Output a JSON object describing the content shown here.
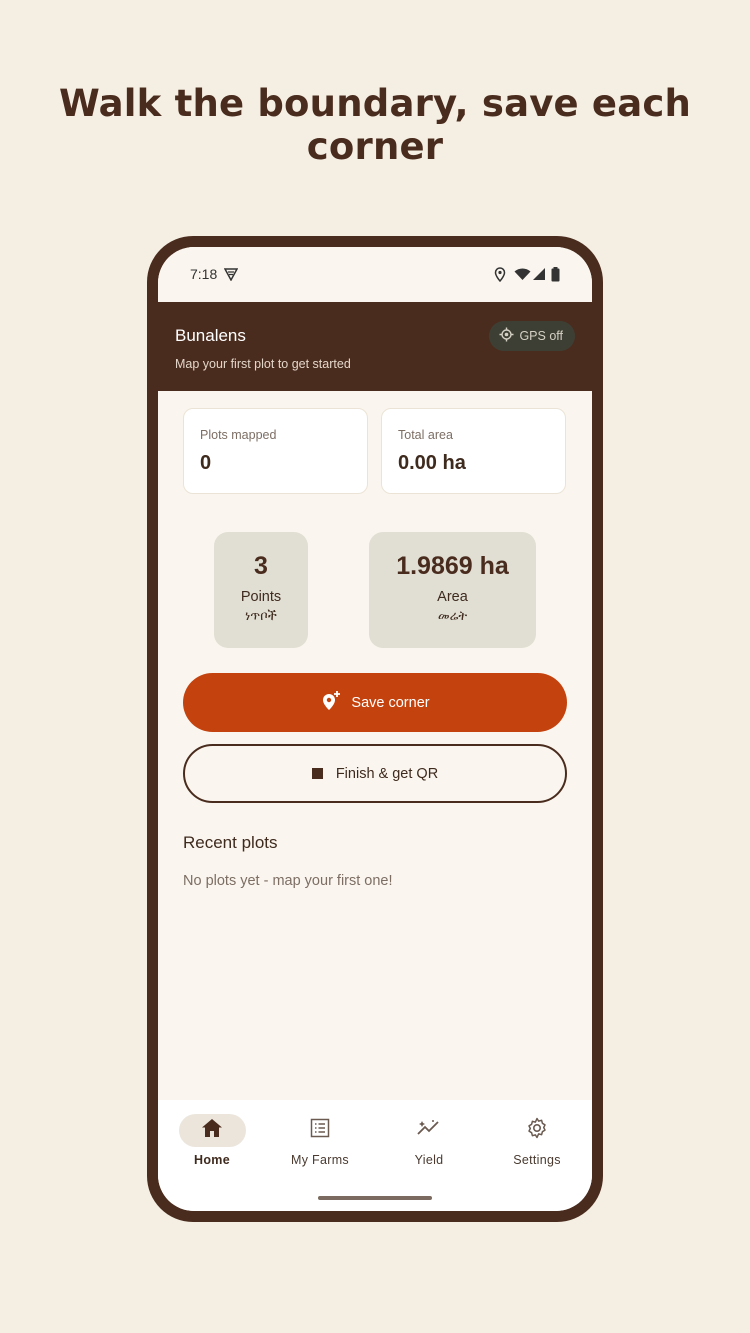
{
  "headline": "Walk the boundary, save each corner",
  "status_bar": {
    "time": "7:18",
    "icons": [
      "shield-icon",
      "location-icon",
      "wifi-icon",
      "signal-icon",
      "battery-icon"
    ]
  },
  "app_bar": {
    "title": "Bunalens",
    "subtitle": "Map your first plot to get started",
    "gps_chip": "GPS off"
  },
  "stats": [
    {
      "label": "Plots mapped",
      "value": "0"
    },
    {
      "label": "Total area",
      "value": "0.00 ha"
    }
  ],
  "metrics": [
    {
      "value": "3",
      "label": "Points",
      "label_am": "ነጥቦች"
    },
    {
      "value": "1.9869 ha",
      "label": "Area",
      "label_am": "መሬት"
    }
  ],
  "buttons": {
    "save_corner": "Save corner",
    "finish": "Finish & get QR"
  },
  "recent": {
    "title": "Recent plots",
    "empty": "No plots yet - map your first one!"
  },
  "nav": [
    {
      "label": "Home",
      "icon": "home-icon",
      "active": true
    },
    {
      "label": "My Farms",
      "icon": "list-icon"
    },
    {
      "label": "Yield",
      "icon": "trend-icon"
    },
    {
      "label": "Settings",
      "icon": "gear-icon"
    }
  ],
  "colors": {
    "brand": "#4a2c1e",
    "accent": "#c4420e",
    "background": "#f5efe3"
  }
}
